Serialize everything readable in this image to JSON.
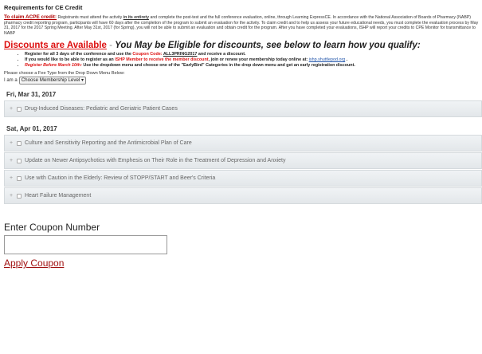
{
  "requirements_title": "Requirements for CE Credit",
  "claim": {
    "lead": "To claim ACPE credit:",
    "t1": "Registrants must attend the activity",
    "emph": "in its entirety",
    "t2": "and complete the post-test and the full conference evaluation, online, through Learning ExpressCE. In accordance with the National Association of Boards of Pharmacy (NABP) pharmacy credit reporting program, participants will have 60 days after the completion of the program to submit an evaluation for the activity. To claim credit and to help us assess your future educational needs, you must complete the evaluation process by May 31, 2017 for the 2017 Spring Meeting. After May 31st, 2017 (for Spring), you will not be able to submit an evaluation and obtain credit for the program. After you have completed your evaluations, ISHP will report your credits to CPE Monitor for transmittance to NABP"
  },
  "discounts": {
    "title": "Discounts are Available",
    "sep": " - ",
    "subtitle": "You May be Eligible for discounts, see below to learn how you qualify:",
    "b1": {
      "a": "Register for all 3 days of the conference and use the ",
      "b": "Coupon Code:",
      "c": "ALL3PRING2017",
      "d": " and receive a discount."
    },
    "b2": {
      "a": "If you would like to be able to register as an ",
      "b": "ISHP Member to receive the member discount",
      "c": ", join or renew your membership today online at: ",
      "link": "ishp.shuttlepod.org",
      "d": " ."
    },
    "b3": {
      "a": "Register Before March 10th:",
      "b": " Use the dropdown menu and choose one of the \"EarlyBird\" Categories in the drop down menu and get an early registration discount."
    }
  },
  "fee": {
    "note": "Please choose a Fee Type from the Drop Down Menu Below:",
    "prefix": "I am a",
    "selected": "Choose Membership Level",
    "arrow": "▾"
  },
  "days": [
    {
      "date": "Fri, Mar 31, 2017",
      "sessions": [
        "Drug-Induced Diseases: Pediatric and Geriatric Patient Cases"
      ]
    },
    {
      "date": "Sat, Apr 01, 2017",
      "sessions": [
        "Culture and Sensitivity Reporting and the Antimicrobial Plan of Care",
        "Update on Newer Antipsychotics with Emphesis on Their Role in the Treatment of Depression and Anxiety",
        "Use with Caution in the Elderly: Review of STOPP/START and Beer's Criteria",
        "Heart Failure Management"
      ]
    }
  ],
  "expand_symbol": "+",
  "coupon": {
    "label": "Enter Coupon Number",
    "value": "",
    "apply": "Apply Coupon"
  }
}
